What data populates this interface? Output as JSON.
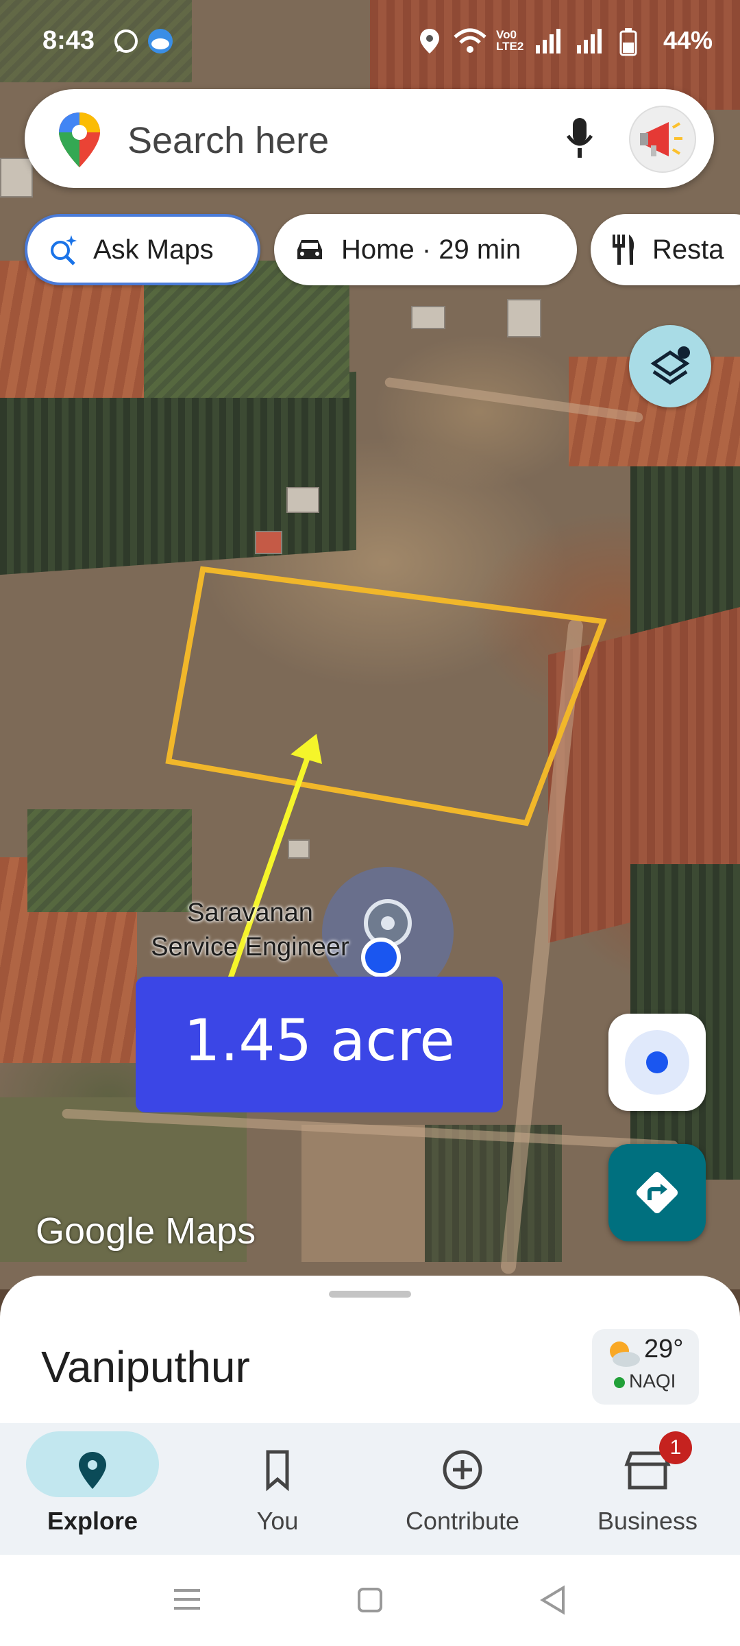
{
  "status_bar": {
    "time": "8:43",
    "battery": "44%",
    "icons": [
      "whatsapp-icon",
      "weather-cloud-icon",
      "location-icon",
      "wifi-icon",
      "volte-icon",
      "signal-icon",
      "signal-icon",
      "battery-icon"
    ],
    "volte_text": "Vo0 LTE2"
  },
  "search": {
    "placeholder": "Search here"
  },
  "chips": [
    {
      "label": "Ask Maps",
      "icon": "sparkle-search-icon"
    },
    {
      "label": "Home · 29 min",
      "icon": "car-icon"
    },
    {
      "label": "Resta",
      "icon": "restaurant-icon"
    }
  ],
  "map": {
    "location_label_line1": "Saravanan",
    "location_label_line2": "Service Engineer",
    "annotation": "1.45 acre",
    "watermark": "Google Maps",
    "colors": {
      "plot_outline": "#f1b72a",
      "arrow": "#f5f52a",
      "annotation_bg": "#3b46e6",
      "location_dot": "#1a56f0"
    }
  },
  "bottom_sheet": {
    "title": "Vaniputhur",
    "weather": {
      "temperature": "29°",
      "aqi": "NAQI",
      "icon": "partly-cloudy-icon"
    }
  },
  "bottom_nav": {
    "items": [
      {
        "label": "Explore",
        "icon": "explore-pin-icon",
        "selected": true
      },
      {
        "label": "You",
        "icon": "bookmark-icon"
      },
      {
        "label": "Contribute",
        "icon": "add-circle-icon"
      },
      {
        "label": "Business",
        "icon": "store-icon",
        "badge": "1"
      }
    ]
  },
  "system_nav": {
    "icons": [
      "menu-icon",
      "home-square-icon",
      "back-triangle-icon"
    ]
  }
}
